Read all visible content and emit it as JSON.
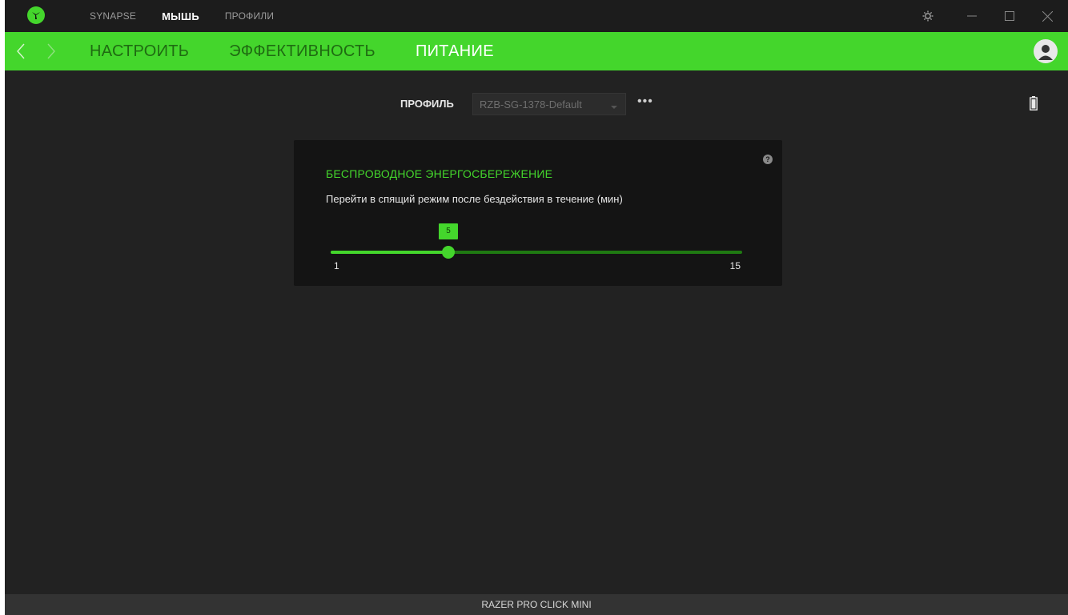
{
  "colors": {
    "accent": "#44d62c",
    "background": "#222222",
    "card": "#141414",
    "titlebar": "#1c1c1c"
  },
  "titlebar": {
    "logo_icon": "razer-logo-icon",
    "nav": [
      {
        "label": "SYNAPSE",
        "active": false
      },
      {
        "label": "МЫШЬ",
        "active": true
      },
      {
        "label": "ПРОФИЛИ",
        "active": false
      }
    ],
    "controls": [
      "settings-icon",
      "minimize-icon",
      "maximize-icon",
      "close-icon"
    ]
  },
  "subnav": {
    "tabs": [
      {
        "label": "НАСТРОИТЬ",
        "active": false
      },
      {
        "label": "ЭФФЕКТИВНОСТЬ",
        "active": false
      },
      {
        "label": "ПИТАНИЕ",
        "active": true
      }
    ]
  },
  "profile": {
    "label": "ПРОФИЛЬ",
    "selected": "RZB-SG-1378-Default",
    "more": "•••"
  },
  "card": {
    "title": "БЕСПРОВОДНОЕ ЭНЕРГОСБЕРЕЖЕНИЕ",
    "description": "Перейти в спящий режим после бездействия в течение (мин)",
    "help": "?",
    "slider": {
      "min": 1,
      "max": 15,
      "value": 5,
      "min_label": "1",
      "max_label": "15",
      "value_label": "5"
    }
  },
  "footer": {
    "device": "RAZER PRO CLICK MINI"
  }
}
